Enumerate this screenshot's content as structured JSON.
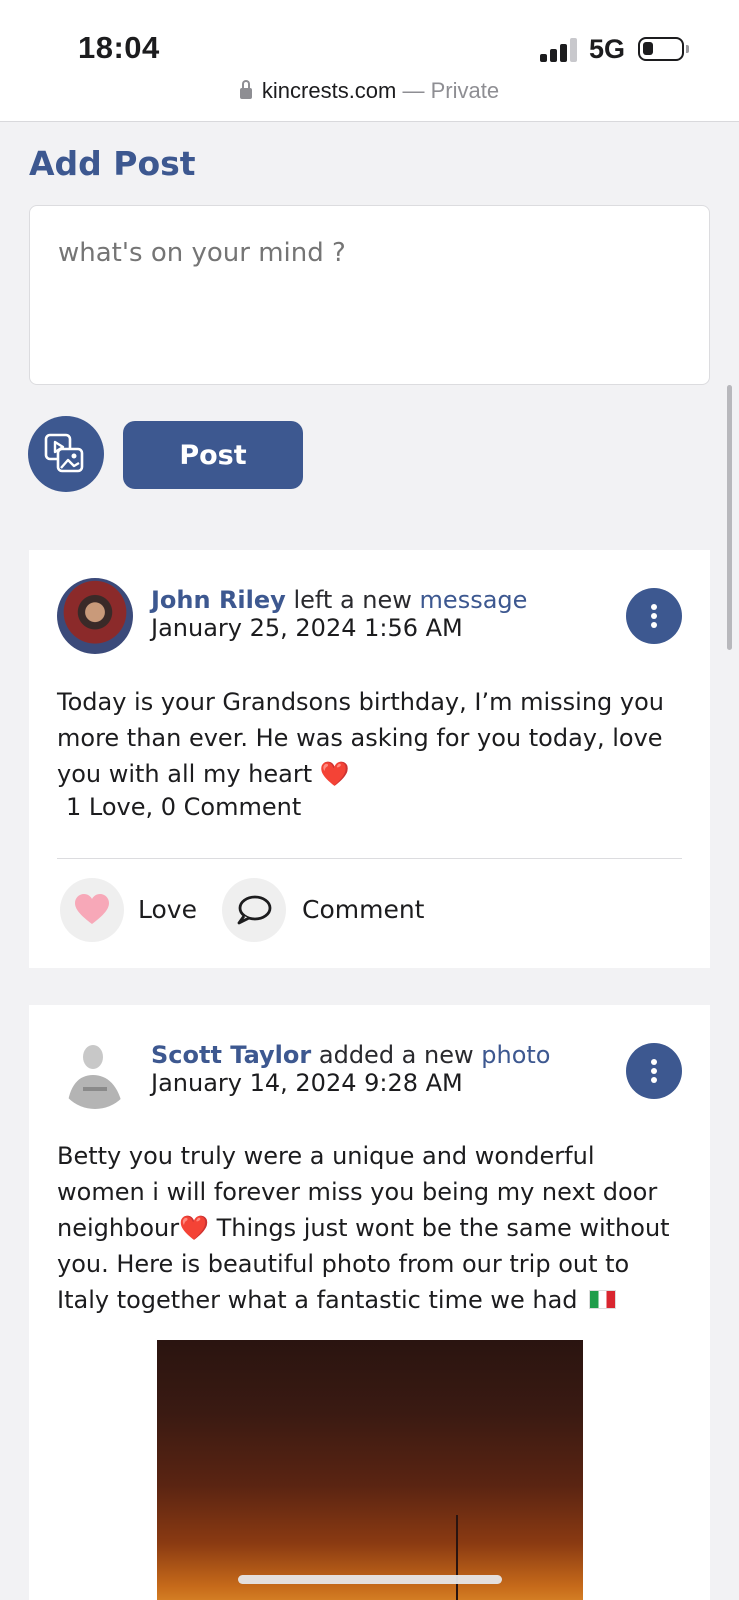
{
  "status_bar": {
    "time": "18:04",
    "network": "5G",
    "url_domain": "kincrests.com",
    "url_suffix": "— Private"
  },
  "composer": {
    "title": "Add Post",
    "placeholder": "what's on your mind ?",
    "post_label": "Post",
    "media_icon": "photo-video-icon"
  },
  "posts": [
    {
      "author": "John Riley",
      "verb": "left a new",
      "object": "message",
      "date": "January 25, 2024 1:56 AM",
      "text": "Today is your Grandsons birthday, I’m missing you more than ever. He was asking for you today, love you with all my heart",
      "text_emoji": "❤️",
      "counts": "1 Love, 0 Comment",
      "love_label": "Love",
      "comment_label": "Comment"
    },
    {
      "author": "Scott Taylor",
      "verb": "added a new",
      "object": "photo",
      "date": "January 14, 2024 9:28 AM",
      "text_part1": "Betty you truly were a unique and wonderful women i will forever miss you being my next door neighbour",
      "text_emoji": "❤️",
      "text_part2": " Things just wont be the same without you. Here is beautiful photo from our trip out to Italy together what a fantastic time we had"
    }
  ],
  "colors": {
    "accent": "#3d5890",
    "background": "#f2f2f4",
    "love_pink": "#f7a8b8"
  }
}
